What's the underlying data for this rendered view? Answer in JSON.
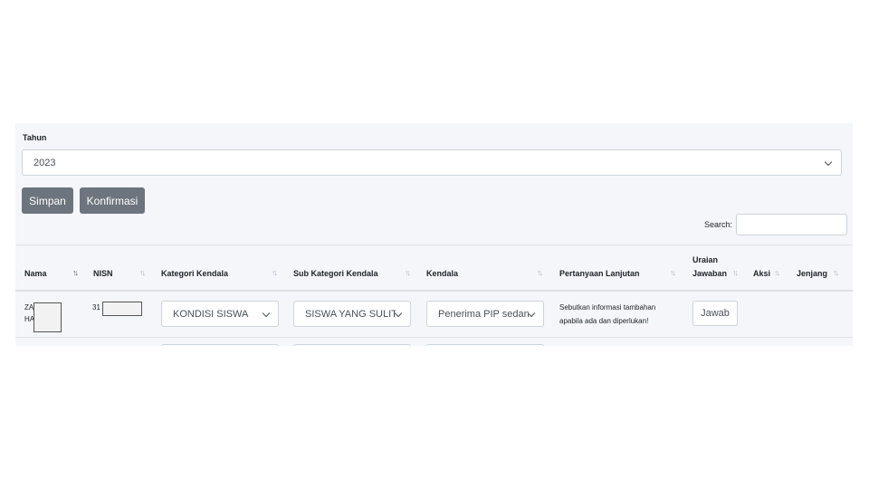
{
  "form": {
    "year_label": "Tahun",
    "year_value": "2023",
    "save_label": "Simpan",
    "confirm_label": "Konfirmasi"
  },
  "search": {
    "label": "Search:",
    "value": ""
  },
  "table": {
    "headers": {
      "nama": "Nama",
      "nisn": "NISN",
      "kategori": "Kategori Kendala",
      "sub_kategori": "Sub Kategori Kendala",
      "kendala": "Kendala",
      "pertanyaan": "Pertanyaan Lanjutan",
      "uraian_line1": "Uraian",
      "uraian_line2": "Jawaban",
      "aksi": "Aksi",
      "jenjang": "Jenjang"
    },
    "row1": {
      "nama_line1": "ZA",
      "nama_line2": "HA",
      "nisn": "31",
      "kategori": "KONDISI SISWA",
      "sub_kategori": "SISWA YANG SULIT DIHUBUNGI",
      "kendala": "Penerima PIP sedang tidak aktif",
      "pertanyaan_line1": "Sebutkan informasi tambahan",
      "pertanyaan_line2": "apabila ada dan diperlukan!",
      "action_label": "Jawab"
    }
  },
  "icons": {
    "sort": "sort-arrows-icon",
    "sort_active": "sort-down-icon",
    "dropdown": "chevron-down-icon"
  }
}
